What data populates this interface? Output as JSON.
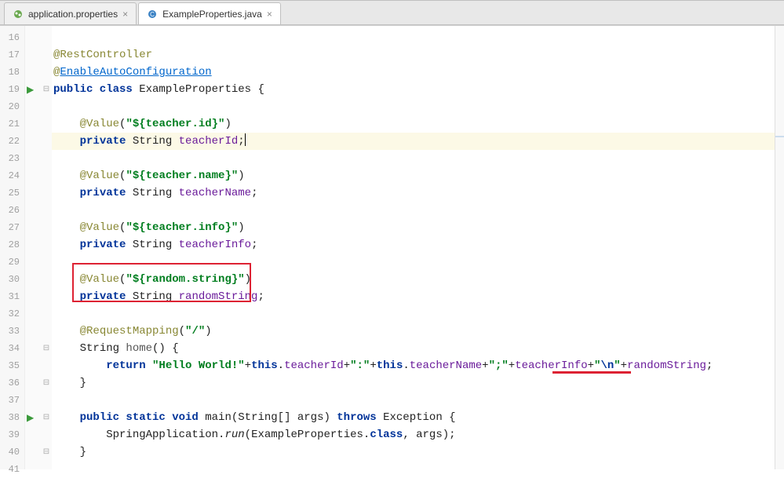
{
  "tabs": [
    {
      "label": "application.properties",
      "icon": "#6aa84f",
      "active": false
    },
    {
      "label": "ExampleProperties.java",
      "icon": "#3b82c4",
      "active": true
    }
  ],
  "lineNumbers": [
    "16",
    "17",
    "18",
    "19",
    "20",
    "21",
    "22",
    "23",
    "24",
    "25",
    "26",
    "27",
    "28",
    "29",
    "30",
    "31",
    "32",
    "33",
    "34",
    "35",
    "36",
    "37",
    "38",
    "39",
    "40",
    "41"
  ],
  "code": {
    "l17": {
      "anno": "@RestController"
    },
    "l18": {
      "anno": "@",
      "link": "EnableAutoConfiguration"
    },
    "l19": {
      "kw": "public class",
      "cls": " ExampleProperties {"
    },
    "l21": {
      "anno": "@Value",
      "p1": "(",
      "str": "\"${teacher.id}\"",
      "p2": ")"
    },
    "l22": {
      "kw": "private",
      "type": " String ",
      "fld": "teacherId",
      "semi": ";"
    },
    "l24": {
      "anno": "@Value",
      "p1": "(",
      "str": "\"${teacher.name}\"",
      "p2": ")"
    },
    "l25": {
      "kw": "private",
      "type": " String ",
      "fld": "teacherName",
      "semi": ";"
    },
    "l27": {
      "anno": "@Value",
      "p1": "(",
      "str": "\"${teacher.info}\"",
      "p2": ")"
    },
    "l28": {
      "kw": "private",
      "type": " String ",
      "fld": "teacherInfo",
      "semi": ";"
    },
    "l30": {
      "anno": "@Value",
      "p1": "(",
      "str": "\"${random.string}\"",
      "p2": ")"
    },
    "l31": {
      "kw": "private",
      "type": " String ",
      "fld": "randomString",
      "semi": ";"
    },
    "l33": {
      "anno": "@RequestMapping",
      "p1": "(",
      "str": "\"/\"",
      "p2": ")"
    },
    "l34": {
      "ret": "String ",
      "mn": "home",
      "rest": "() {"
    },
    "l35": {
      "kw": "return ",
      "s1": "\"Hello World!\"",
      "p1": "+",
      "kw2": "this",
      "p2": ".",
      "f1": "teacherId",
      "p3": "+",
      "s2": "\":\"",
      "p4": "+",
      "kw3": "this",
      "p5": ".",
      "f2": "teacherName",
      "p6": "+",
      "s3": "\";\"",
      "p7": "+",
      "f3": "teacherInfo",
      "p8": "+",
      "s4a": "\"",
      "esc": "\\n",
      "s4b": "\"",
      "p9": "+",
      "f4": "randomString",
      "semi": ";"
    },
    "l36": {
      "brace": "}"
    },
    "l38": {
      "kw": "public static void",
      "mn": " main",
      "sig1": "(String[] args) ",
      "kw2": "throws",
      "sig2": " Exception {"
    },
    "l39": {
      "cls": "SpringApplication.",
      "m": "run",
      "p1": "(ExampleProperties.",
      "kw": "class",
      "p2": ", args);"
    },
    "l40": {
      "brace": "}"
    }
  }
}
